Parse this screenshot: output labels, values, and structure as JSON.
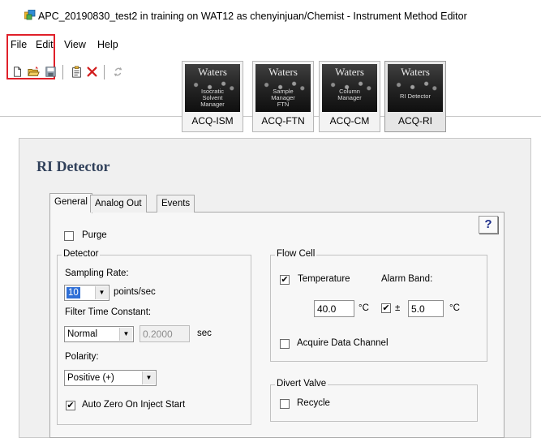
{
  "window": {
    "title": "APC_20190830_test2 in training on WAT12 as chenyinjuan/Chemist - Instrument Method Editor"
  },
  "menu": [
    "File",
    "Edit",
    "View",
    "Help"
  ],
  "toolbar": {
    "buttons": [
      "new-icon",
      "open-icon",
      "save-icon",
      "report-icon",
      "delete-icon",
      "refresh-icon"
    ]
  },
  "modules": [
    {
      "brand": "Waters",
      "subtitle": "Isocratic\nSolvent\nManager",
      "label": "ACQ-ISM",
      "active": false
    },
    {
      "brand": "Waters",
      "subtitle": "Sample\nManager\nFTN",
      "label": "ACQ-FTN",
      "active": false
    },
    {
      "brand": "Waters",
      "subtitle": "Column\nManager",
      "label": "ACQ-CM",
      "active": false
    },
    {
      "brand": "Waters",
      "subtitle": "RI Detector",
      "label": "ACQ-RI",
      "active": true
    }
  ],
  "panel": {
    "title": "RI Detector",
    "tabs": [
      "General",
      "Analog Out",
      "Events"
    ],
    "active_tab": "General",
    "help_label": "?"
  },
  "general": {
    "purge": {
      "label": "Purge",
      "checked": false
    },
    "detector": {
      "legend": "Detector",
      "sampling_rate_label": "Sampling Rate:",
      "sampling_rate_value": "10",
      "sampling_rate_unit": "points/sec",
      "filter_label": "Filter Time Constant:",
      "filter_mode": "Normal",
      "filter_value": "0.2000",
      "filter_unit": "sec",
      "polarity_label": "Polarity:",
      "polarity_value": "Positive (+)",
      "auto_zero": {
        "label": "Auto Zero On Inject Start",
        "checked": true
      }
    },
    "flow_cell": {
      "legend": "Flow Cell",
      "temperature": {
        "label": "Temperature",
        "checked": true
      },
      "temperature_value": "40.0",
      "temperature_unit": "°C",
      "alarm_band_label": "Alarm Band:",
      "alarm_checked": true,
      "alarm_prefix": "±",
      "alarm_value": "5.0",
      "alarm_unit": "°C",
      "acquire": {
        "label": "Acquire Data Channel",
        "checked": false
      }
    },
    "divert_valve": {
      "legend": "Divert Valve",
      "recycle": {
        "label": "Recycle",
        "checked": false
      }
    }
  },
  "colors": {
    "highlight_box": "#e0202a",
    "panel_title": "#30405a",
    "selection": "#2f6fd6"
  }
}
